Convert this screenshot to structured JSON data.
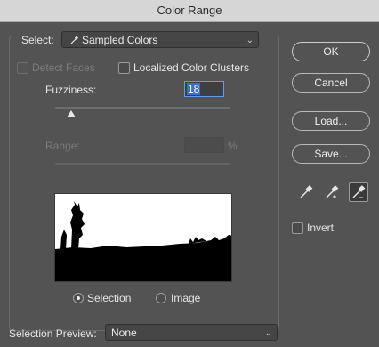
{
  "window": {
    "title": "Color Range"
  },
  "select": {
    "label": "Select:",
    "value": "Sampled Colors",
    "icon": "eyedropper-icon"
  },
  "options": {
    "detect_faces": {
      "label": "Detect Faces",
      "checked": false,
      "enabled": false
    },
    "localized_clusters": {
      "label": "Localized Color Clusters",
      "checked": false
    }
  },
  "fuzziness": {
    "label": "Fuzziness:",
    "value": "18",
    "level": 0.09
  },
  "range": {
    "label": "Range:",
    "value": "",
    "unit": "%",
    "enabled": false
  },
  "preview_mode": {
    "options": [
      {
        "label": "Selection",
        "selected": true
      },
      {
        "label": "Image",
        "selected": false
      }
    ]
  },
  "selection_preview": {
    "label": "Selection Preview:",
    "value": "None"
  },
  "buttons": {
    "ok": "OK",
    "cancel": "Cancel",
    "load": "Load...",
    "save": "Save..."
  },
  "eyedroppers": [
    {
      "name": "eyedropper-icon",
      "active": false
    },
    {
      "name": "eyedropper-plus-icon",
      "active": false
    },
    {
      "name": "eyedropper-minus-icon",
      "active": true
    }
  ],
  "invert": {
    "label": "Invert",
    "checked": false
  }
}
